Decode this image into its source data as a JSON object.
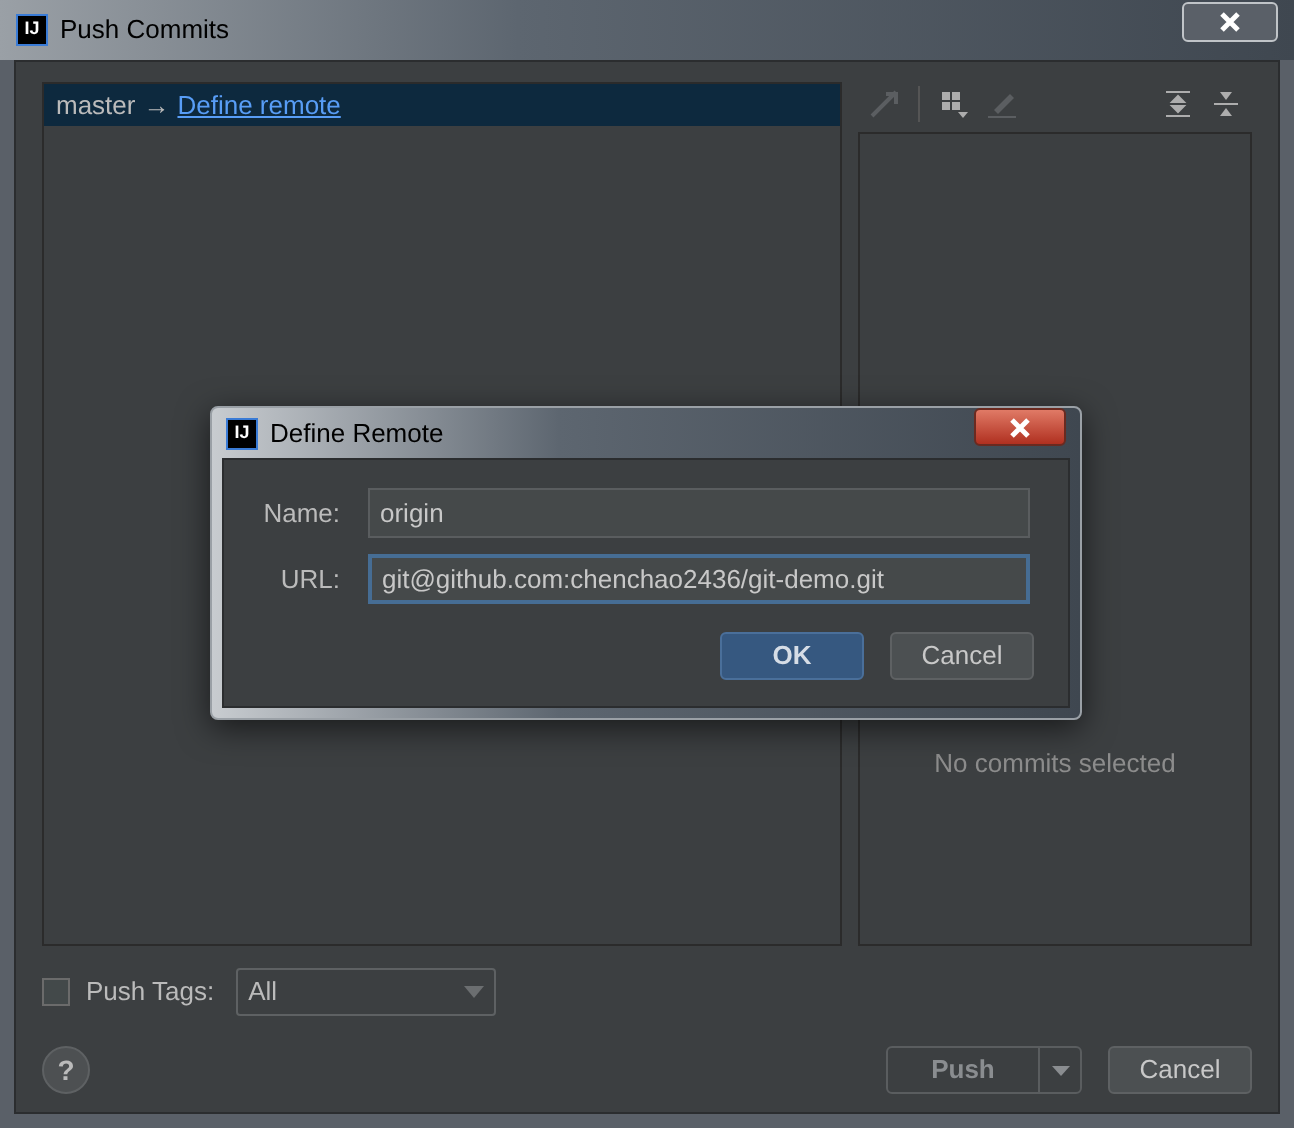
{
  "window": {
    "title": "Push Commits",
    "app_icon": "IJ"
  },
  "branch_row": {
    "branch": "master",
    "arrow": "→",
    "link": "Define remote",
    "selected": true
  },
  "details": {
    "empty_text": "No commits selected"
  },
  "push_tags": {
    "label": "Push Tags:",
    "checked": false,
    "value": "All"
  },
  "buttons": [
    {
      "label": "Push",
      "kind": "split",
      "disabled": true
    },
    {
      "label": "Cancel",
      "kind": "plain",
      "disabled": false
    }
  ],
  "help": "?",
  "dialog": {
    "title": "Define Remote",
    "app_icon": "IJ",
    "fields": [
      {
        "label": "Name:",
        "value": "origin",
        "focused": false
      },
      {
        "label": "URL:",
        "value": "git@github.com:chenchao2436/git-demo.git",
        "focused": true
      }
    ],
    "buttons": [
      {
        "label": "OK",
        "kind": "primary"
      },
      {
        "label": "Cancel",
        "kind": "plain"
      }
    ]
  }
}
